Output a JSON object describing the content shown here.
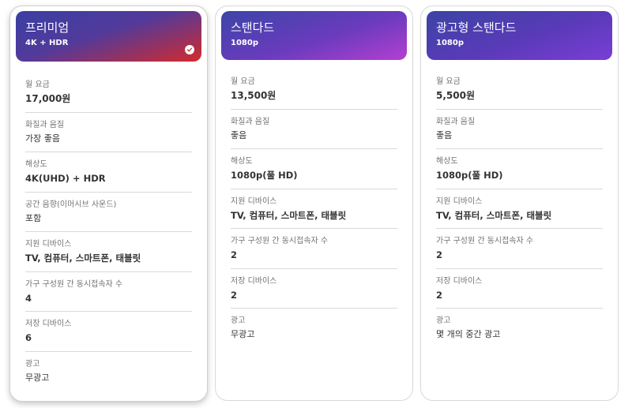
{
  "plans": [
    {
      "name": "프리미엄",
      "resolution": "4K + HDR",
      "selected": true,
      "rows": [
        {
          "label": "월 요금",
          "value": "17,000원"
        },
        {
          "label": "화질과 음질",
          "value": "가장 좋음"
        },
        {
          "label": "해상도",
          "value": "4K(UHD) + HDR"
        },
        {
          "label": "공간 음향(이머시브 사운드)",
          "value": "포함"
        },
        {
          "label": "지원 디바이스",
          "value": "TV, 컴퓨터, 스마트폰, 태블릿"
        },
        {
          "label": "가구 구성원 간 동시접속자 수",
          "value": "4"
        },
        {
          "label": "저장 디바이스",
          "value": "6"
        },
        {
          "label": "광고",
          "value": "무광고"
        }
      ]
    },
    {
      "name": "스탠다드",
      "resolution": "1080p",
      "selected": false,
      "rows": [
        {
          "label": "월 요금",
          "value": "13,500원"
        },
        {
          "label": "화질과 음질",
          "value": "좋음"
        },
        {
          "label": "해상도",
          "value": "1080p(풀 HD)"
        },
        {
          "label": "지원 디바이스",
          "value": "TV, 컴퓨터, 스마트폰, 태블릿"
        },
        {
          "label": "가구 구성원 간 동시접속자 수",
          "value": "2"
        },
        {
          "label": "저장 디바이스",
          "value": "2"
        },
        {
          "label": "광고",
          "value": "무광고"
        }
      ]
    },
    {
      "name": "광고형 스탠다드",
      "resolution": "1080p",
      "selected": false,
      "rows": [
        {
          "label": "월 요금",
          "value": "5,500원"
        },
        {
          "label": "화질과 음질",
          "value": "좋음"
        },
        {
          "label": "해상도",
          "value": "1080p(풀 HD)"
        },
        {
          "label": "지원 디바이스",
          "value": "TV, 컴퓨터, 스마트폰, 태블릿"
        },
        {
          "label": "가구 구성원 간 동시접속자 수",
          "value": "2"
        },
        {
          "label": "저장 디바이스",
          "value": "2"
        },
        {
          "label": "광고",
          "value": "몇 개의 중간 광고"
        }
      ]
    }
  ],
  "icons": {
    "selected": "check-circle-icon"
  },
  "colors": {
    "premium_gradient_end": "#d22a2c",
    "standard_gradient_end": "#b43fd1",
    "ads_gradient_end": "#7a3ed6"
  }
}
